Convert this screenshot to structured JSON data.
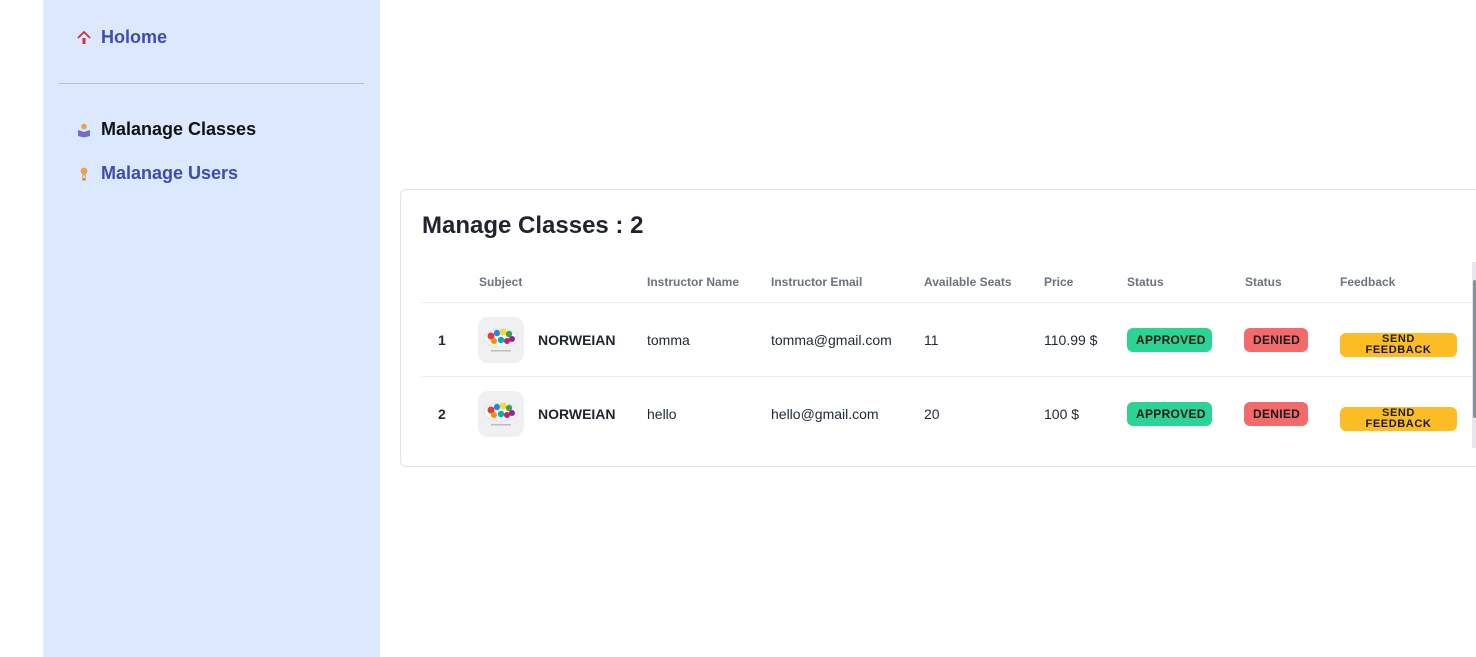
{
  "sidebar": {
    "items": [
      {
        "label": "Holome",
        "icon": "home-icon",
        "color": "#3f4bb0"
      },
      {
        "label": "Malanage Classes",
        "icon": "classroom-icon",
        "color": "#111111",
        "active": true
      },
      {
        "label": "Malanage Users",
        "icon": "user-icon",
        "color": "#3f4bb0"
      }
    ]
  },
  "main": {
    "title": "Manage Classes : 2",
    "table": {
      "headers": [
        "",
        "Subject",
        "Instructor Name",
        "Instructor Email",
        "Available Seats",
        "Price",
        "Status",
        "Status",
        "Feedback"
      ],
      "rows": [
        {
          "index": "1",
          "subject": "NORWEIAN",
          "instructor_name": "tomma",
          "instructor_email": "tomma@gmail.com",
          "available_seats": "11",
          "price": "110.99 $",
          "status_approved": "APPROVED",
          "status_denied": "DENIED",
          "feedback_line1": "SEND",
          "feedback_line2": "FEEDBACK"
        },
        {
          "index": "2",
          "subject": "NORWEIAN",
          "instructor_name": "hello",
          "instructor_email": "hello@gmail.com",
          "available_seats": "20",
          "price": "100 $",
          "status_approved": "APPROVED",
          "status_denied": "DENIED",
          "feedback_line1": "SEND",
          "feedback_line2": "FEEDBACK"
        }
      ]
    }
  },
  "colors": {
    "sidebar_bg": "#dbe8fe",
    "approved": "#2bd394",
    "denied": "#f26a6a",
    "feedback": "#fbbd23"
  }
}
